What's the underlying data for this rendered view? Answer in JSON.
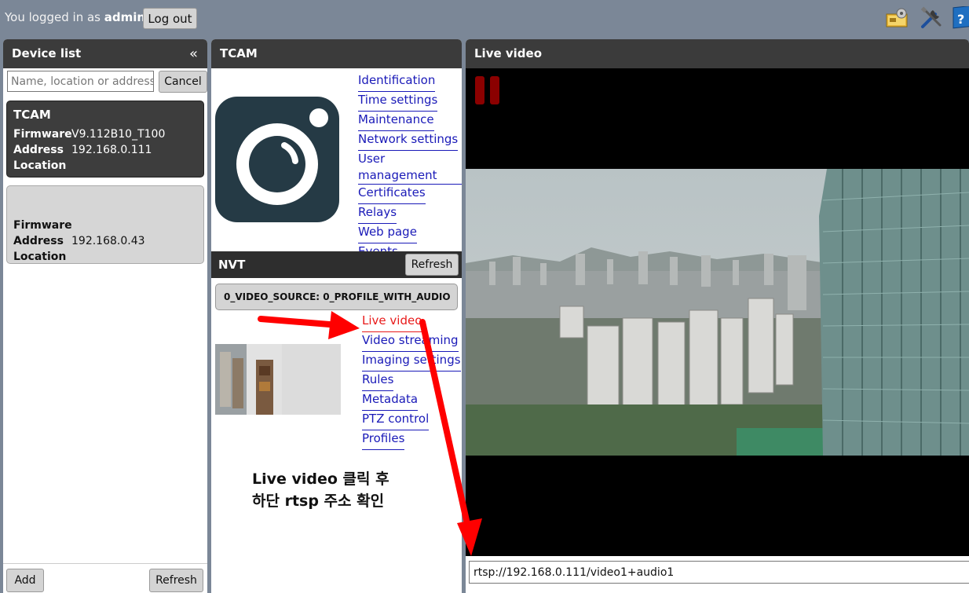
{
  "topbar": {
    "login_prefix": "You logged in as",
    "username": "admin",
    "logout_label": "Log out"
  },
  "device_panel": {
    "title": "Device list",
    "collapse_glyph": "«",
    "search_placeholder": "Name, location or address",
    "cancel_label": "Cancel",
    "devices": [
      {
        "name": "TCAM",
        "firmware_label": "Firmware",
        "firmware": "V9.112B10_T100",
        "address_label": "Address",
        "address": "192.168.0.111",
        "location_label": "Location",
        "location": ""
      },
      {
        "name": "",
        "firmware_label": "Firmware",
        "firmware": "",
        "address_label": "Address",
        "address": "192.168.0.43",
        "location_label": "Location",
        "location": ""
      }
    ],
    "add_label": "Add",
    "refresh_label": "Refresh"
  },
  "tcam_panel": {
    "title": "TCAM",
    "menu": [
      "Identification",
      "Time settings",
      "Maintenance",
      "Network settings",
      "User management",
      "Certificates",
      "Relays",
      "Web page",
      "Events"
    ],
    "nvt_title": "NVT",
    "nvt_refresh_label": "Refresh",
    "profile": "0_VIDEO_SOURCE: 0_PROFILE_WITH_AUDIO",
    "nvt_menu": [
      "Live video",
      "Video streaming",
      "Imaging settings",
      "Rules",
      "Metadata",
      "PTZ control",
      "Profiles"
    ],
    "annotation_line1": "Live video 클릭 후",
    "annotation_line2": "하단 rtsp 주소 확인"
  },
  "live_panel": {
    "title": "Live video",
    "rtsp_url": "rtsp://192.168.0.111/video1+audio1"
  },
  "icons": [
    "camera-settings-icon",
    "tools-icon",
    "help-icon",
    "collapse-icon",
    "pause-icon",
    "camera-logo-icon"
  ],
  "colors": {
    "accent_link": "#1a1ab8",
    "active_link": "#e81a1a",
    "header": "#3b3b3b",
    "topbar": "#7b8797"
  }
}
